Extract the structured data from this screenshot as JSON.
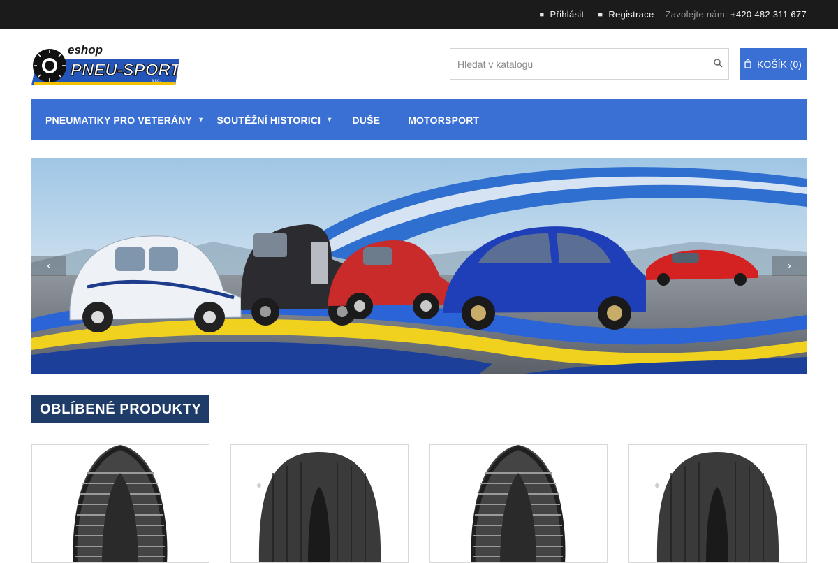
{
  "topbar": {
    "login_label": "Přihlásit",
    "register_label": "Registrace",
    "call_label": "Zavolejte nám:",
    "phone": "+420 482 311 677"
  },
  "header": {
    "logo_top_text": "eshop",
    "logo_main_text": "PNEU-SPORT",
    "logo_sub_text": "s.r.o.",
    "search_placeholder": "Hledat v katalogu",
    "cart_label": "KOŠÍK (0)"
  },
  "nav": {
    "items": [
      {
        "label": "PNEUMATIKY PRO VETERÁNY",
        "has_submenu": true
      },
      {
        "label": "SOUTĚŽNÍ HISTORICI",
        "has_submenu": true
      },
      {
        "label": "DUŠE",
        "has_submenu": false
      },
      {
        "label": "MOTORSPORT",
        "has_submenu": false
      }
    ]
  },
  "slider": {
    "prev_icon": "chevron-left-icon",
    "next_icon": "chevron-right-icon"
  },
  "section": {
    "title": "OBLÍBENÉ PRODUKTY"
  },
  "products": [
    {
      "image": "vintage-tyre-ribbed"
    },
    {
      "image": "racing-slick-tyre"
    },
    {
      "image": "vintage-tyre-ribbed"
    },
    {
      "image": "racing-slick-tyre"
    }
  ],
  "colors": {
    "topbar": "#1b1b1b",
    "accent": "#3a6fd4",
    "section_title": "#1f3b68"
  }
}
